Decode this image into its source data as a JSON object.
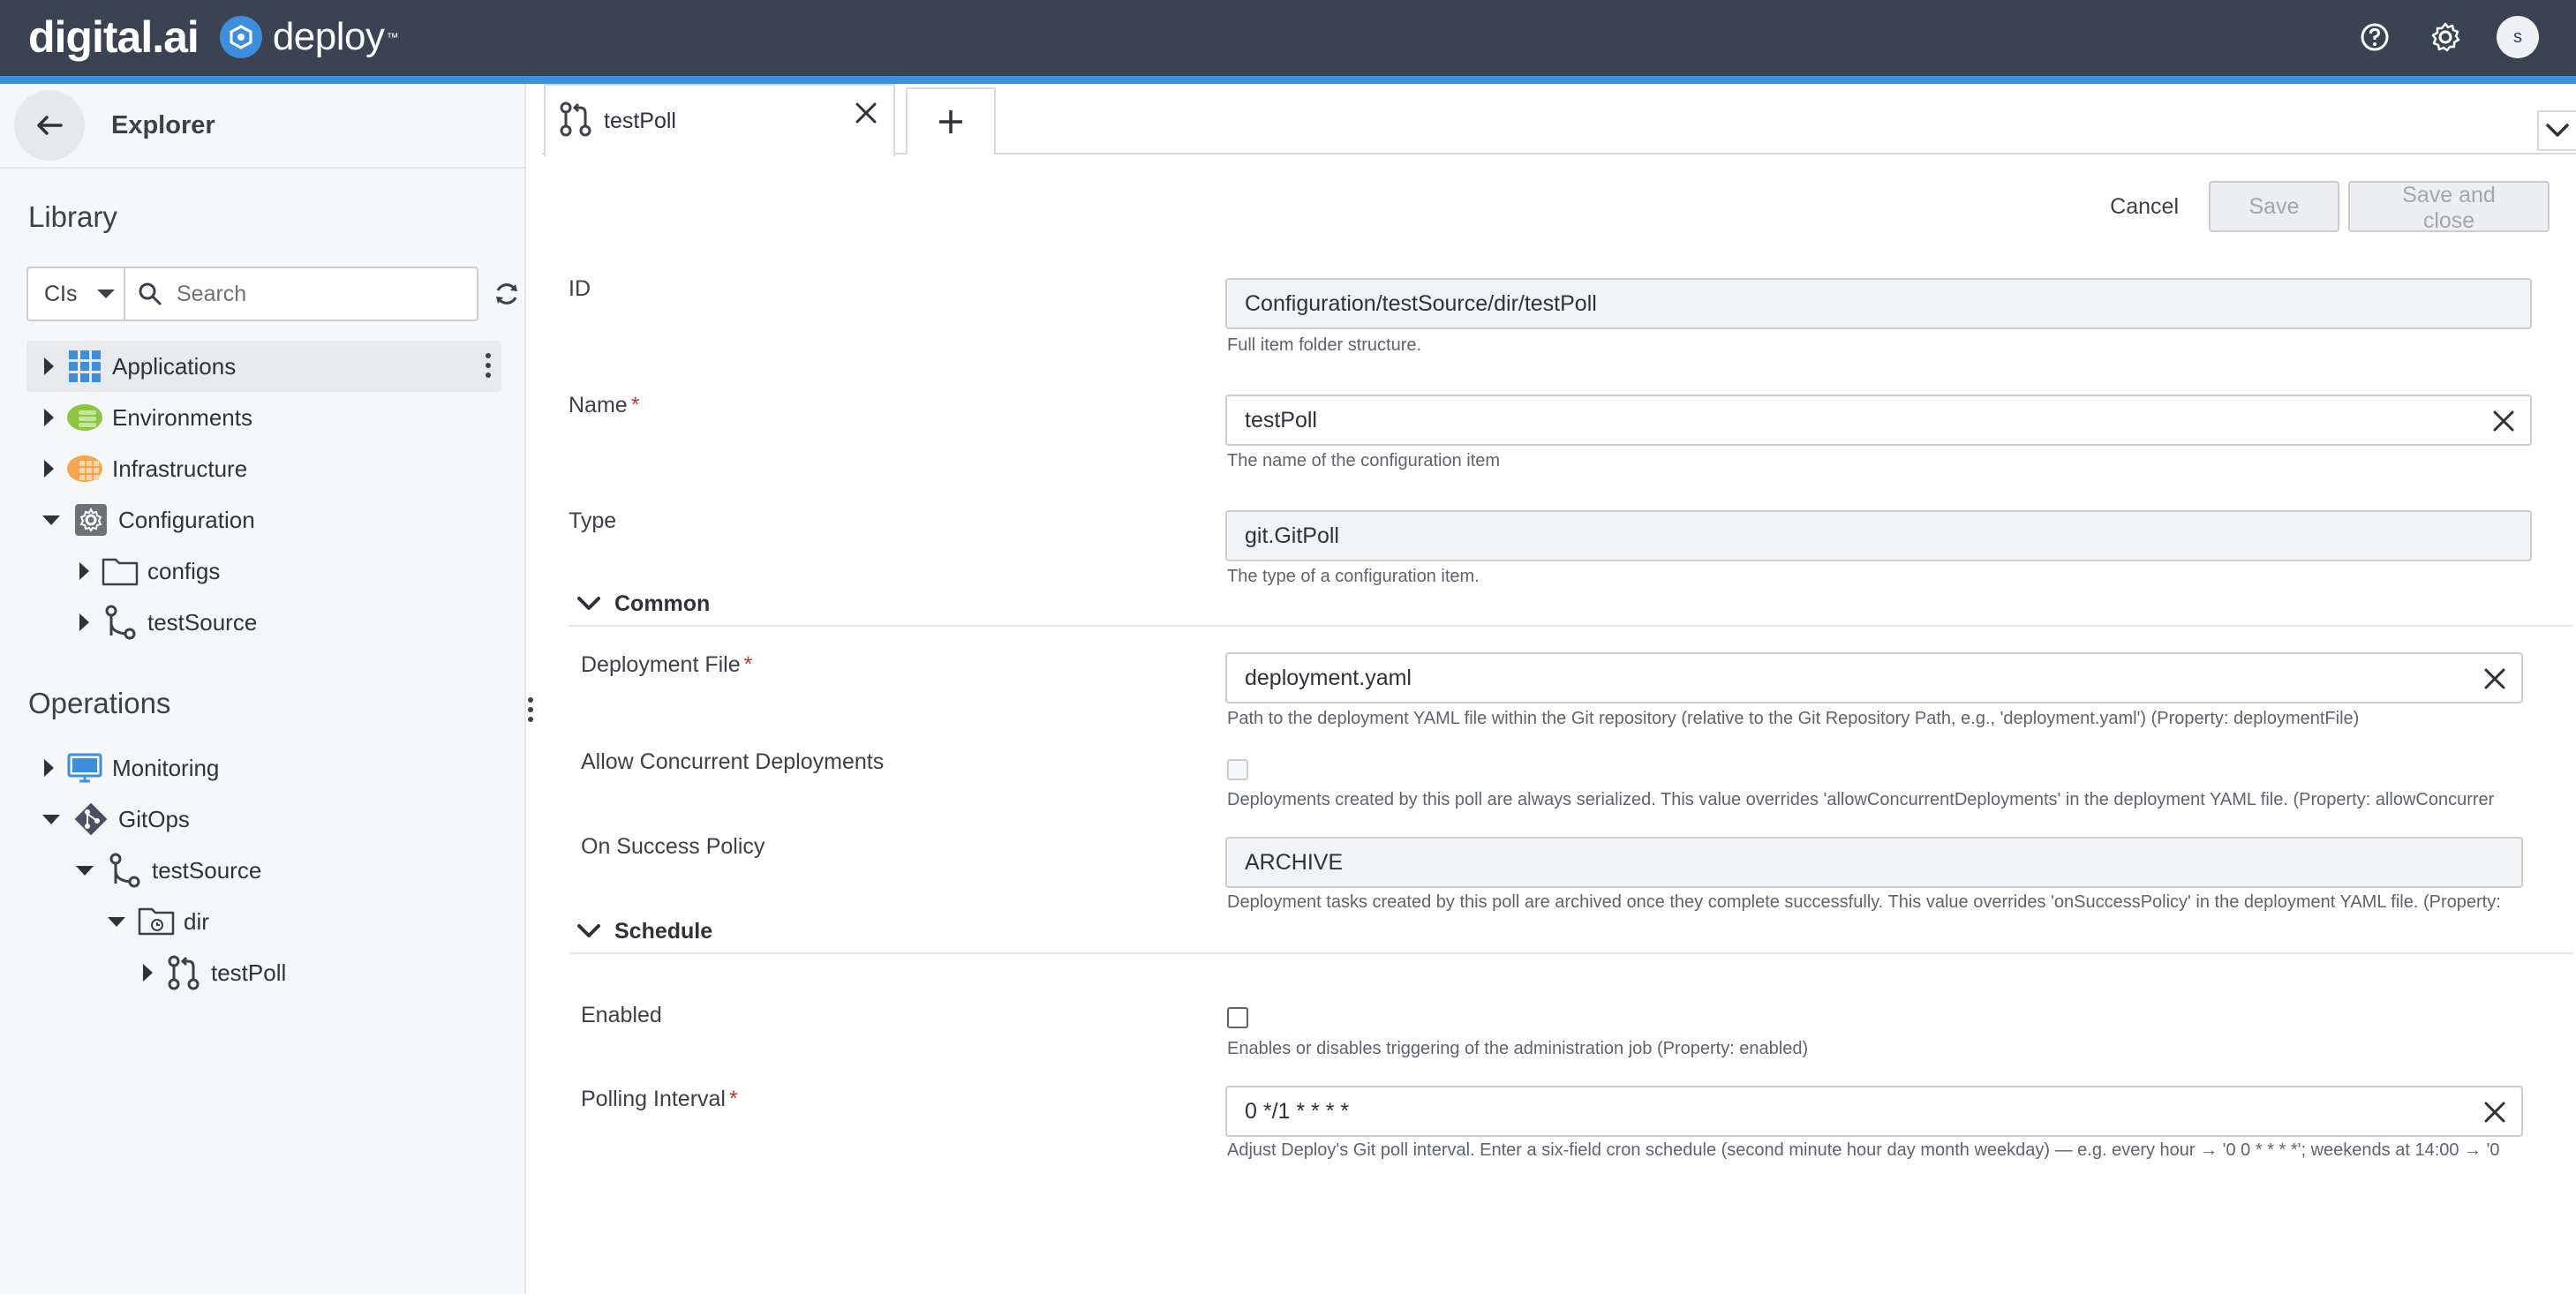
{
  "header": {
    "brand_text": "digital.ai",
    "product_text": "deploy",
    "trademark": "™",
    "user_initial": "s",
    "icons": [
      "help-icon",
      "settings-icon"
    ]
  },
  "sidebar": {
    "title": "Explorer",
    "library_title": "Library",
    "search": {
      "type_value": "CIs",
      "placeholder": "Search"
    },
    "library_items": [
      {
        "label": "Applications",
        "icon": "applications-icon",
        "expanded": false,
        "selected": true
      },
      {
        "label": "Environments",
        "icon": "environments-icon",
        "expanded": false
      },
      {
        "label": "Infrastructure",
        "icon": "infrastructure-icon",
        "expanded": false
      },
      {
        "label": "Configuration",
        "icon": "configuration-icon",
        "expanded": true
      },
      {
        "label": "configs",
        "icon": "folder-icon",
        "expanded": false
      },
      {
        "label": "testSource",
        "icon": "git-source-icon",
        "expanded": false
      }
    ],
    "operations_title": "Operations",
    "operations_items": [
      {
        "label": "Monitoring",
        "icon": "monitor-icon",
        "expanded": false
      },
      {
        "label": "GitOps",
        "icon": "git-icon",
        "expanded": true
      },
      {
        "label": "testSource",
        "icon": "git-source-icon",
        "expanded": true
      },
      {
        "label": "dir",
        "icon": "folder-icon",
        "expanded": true
      },
      {
        "label": "testPoll",
        "icon": "git-poll-icon",
        "expanded": false
      }
    ]
  },
  "tabs": [
    {
      "label": "testPoll",
      "icon": "git-poll-icon"
    }
  ],
  "actions": {
    "cancel": "Cancel",
    "save": "Save",
    "save_close": "Save and close"
  },
  "form": {
    "id": {
      "label": "ID",
      "value": "Configuration/testSource/dir/testPoll",
      "help": "Full item folder structure."
    },
    "name": {
      "label": "Name",
      "required": "*",
      "value": "testPoll",
      "help": "The name of the configuration item"
    },
    "type": {
      "label": "Type",
      "value": "git.GitPoll",
      "help": "The type of a configuration item."
    },
    "common": {
      "title": "Common",
      "deployment_file": {
        "label": "Deployment File",
        "required": "*",
        "value": "deployment.yaml",
        "help": "Path to the deployment YAML file within the Git repository (relative to the Git Repository Path, e.g., 'deployment.yaml') (Property: deploymentFile)"
      },
      "allow_concurrent": {
        "label": "Allow Concurrent Deployments",
        "checked": false,
        "help": "Deployments created by this poll are always serialized. This value overrides 'allowConcurrentDeployments' in the deployment YAML file. (Property: allowConcurrer"
      },
      "on_success": {
        "label": "On Success Policy",
        "value": "ARCHIVE",
        "help": "Deployment tasks created by this poll are archived once they complete successfully. This value overrides 'onSuccessPolicy' in the deployment YAML file. (Property:"
      }
    },
    "schedule": {
      "title": "Schedule",
      "enabled": {
        "label": "Enabled",
        "checked": false,
        "help": "Enables or disables triggering of the administration job (Property: enabled)"
      },
      "polling_interval": {
        "label": "Polling Interval",
        "required": "*",
        "value": "0 */1 * * * *",
        "help": "Adjust Deploy's Git poll interval. Enter a six-field cron schedule (second minute hour day month weekday) — e.g. every hour → '0 0 * * * *'; weekends at 14:00 → '0"
      }
    }
  },
  "colors": {
    "navbar": "#3b4252",
    "accent": "#3d8fde",
    "required": "#c0392b"
  }
}
